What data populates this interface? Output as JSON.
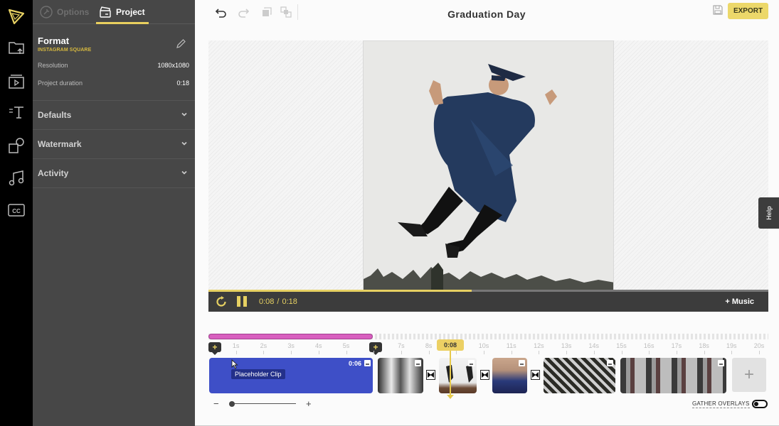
{
  "panel": {
    "tabs": [
      {
        "label": "Options",
        "icon": "wrench-icon",
        "active": false
      },
      {
        "label": "Project",
        "icon": "clapperboard-icon",
        "active": true
      }
    ],
    "format": {
      "title": "Format",
      "subtitle": "INSTAGRAM SQUARE",
      "rows": [
        {
          "label": "Resolution",
          "value": "1080x1080"
        },
        {
          "label": "Project duration",
          "value": "0:18"
        }
      ]
    },
    "sections": [
      {
        "label": "Defaults"
      },
      {
        "label": "Watermark"
      },
      {
        "label": "Activity"
      }
    ]
  },
  "rail": {
    "items": [
      "logo-icon",
      "upload-folder-icon",
      "media-icon",
      "text-icon",
      "shapes-icon",
      "music-icon",
      "captions-icon"
    ]
  },
  "header": {
    "title": "Graduation Day",
    "export_label": "EXPORT"
  },
  "player": {
    "current_time": "0:08",
    "separator": "/",
    "total_time": "0:18",
    "progress_fraction": 0.47,
    "music_label": "+ Music",
    "help_label": "Help"
  },
  "timeline": {
    "ruler": [
      "1s",
      "2s",
      "3s",
      "4s",
      "5s",
      "",
      "7s",
      "8s",
      "",
      "10s",
      "11s",
      "12s",
      "13s",
      "14s",
      "15s",
      "16s",
      "17s",
      "18s",
      "19s",
      "20s"
    ],
    "playhead_label": "0:08",
    "placeholder_clip": {
      "duration": "0:06",
      "tooltip": "Placeholder Clip"
    },
    "gather_overlays_label": "GATHER OVERLAYS",
    "gather_overlays_on": false,
    "add_label": "+"
  },
  "colors": {
    "accent": "#e6d062",
    "placeholder": "#3e4fc7",
    "scrub": "#d85fbf"
  }
}
